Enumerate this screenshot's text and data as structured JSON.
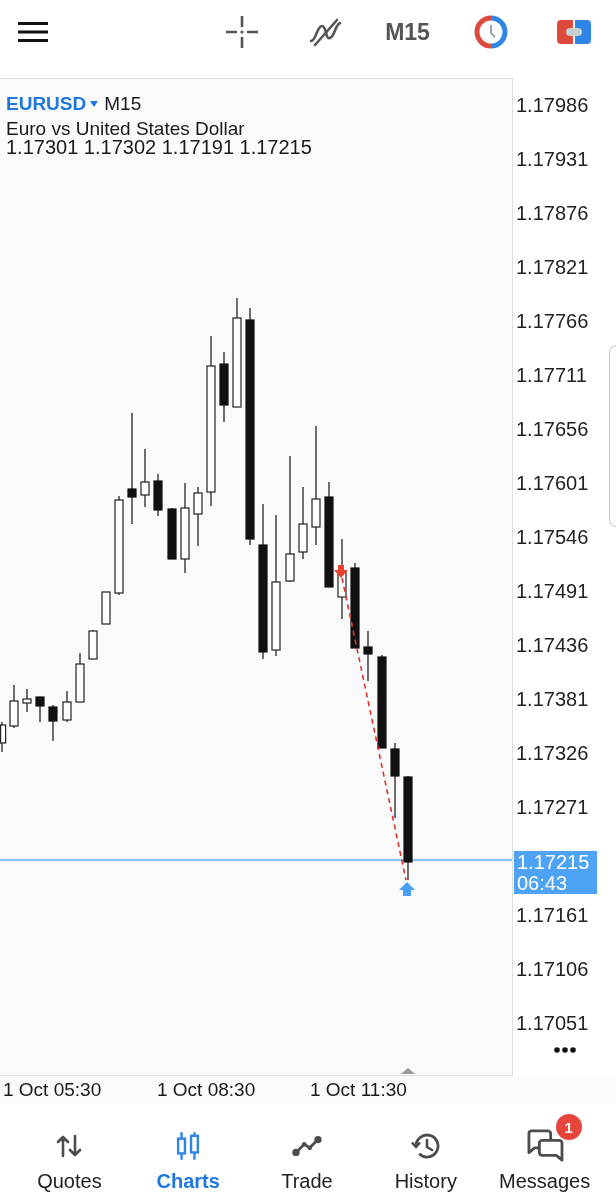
{
  "toolbar": {
    "timeframe": "M15"
  },
  "chart": {
    "symbol": "EURUSD",
    "timeframe": "M15",
    "description": "Euro vs United States Dollar",
    "ohlc": "1.17301 1.17302 1.17191 1.17215",
    "price_axis": [
      {
        "kind": "tick",
        "text": "1.17986"
      },
      {
        "kind": "tick",
        "text": "1.17931"
      },
      {
        "kind": "tick",
        "text": "1.17876"
      },
      {
        "kind": "tick",
        "text": "1.17821"
      },
      {
        "kind": "tick",
        "text": "1.17766"
      },
      {
        "kind": "tick",
        "text": "1.17711"
      },
      {
        "kind": "tick",
        "text": "1.17656"
      },
      {
        "kind": "tick",
        "text": "1.17601"
      },
      {
        "kind": "tick",
        "text": "1.17546"
      },
      {
        "kind": "tick",
        "text": "1.17491"
      },
      {
        "kind": "tick",
        "text": "1.17436"
      },
      {
        "kind": "tick",
        "text": "1.17381"
      },
      {
        "kind": "tick",
        "text": "1.17326"
      },
      {
        "kind": "tick",
        "text": "1.17271"
      },
      {
        "kind": "current",
        "price": "1.17215",
        "countdown": "06:43"
      },
      {
        "kind": "tick",
        "text": "1.17161"
      },
      {
        "kind": "tick",
        "text": "1.17106"
      },
      {
        "kind": "tick",
        "text": "1.17051"
      }
    ],
    "time_axis": [
      "1 Oct 05:30",
      "1 Oct 08:30",
      "1 Oct 11:30"
    ]
  },
  "bottom_nav": [
    {
      "kind": "quotes",
      "label": "Quotes",
      "selected": false
    },
    {
      "kind": "charts",
      "label": "Charts",
      "selected": true
    },
    {
      "kind": "trade",
      "label": "Trade",
      "selected": false
    },
    {
      "kind": "history",
      "label": "History",
      "selected": false
    },
    {
      "kind": "messages",
      "label": "Messages",
      "selected": false,
      "badge": "1"
    }
  ]
}
